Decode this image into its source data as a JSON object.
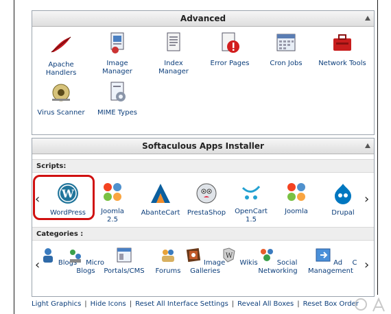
{
  "advanced": {
    "title": "Advanced",
    "items": [
      {
        "label": "Apache\nHandlers",
        "icon": "feather-icon"
      },
      {
        "label": "Image\nManager",
        "icon": "image-manager-icon"
      },
      {
        "label": "Index\nManager",
        "icon": "index-manager-icon"
      },
      {
        "label": "Error Pages",
        "icon": "error-pages-icon"
      },
      {
        "label": "Cron Jobs",
        "icon": "cron-jobs-icon"
      },
      {
        "label": "Network Tools",
        "icon": "network-tools-icon"
      },
      {
        "label": "Virus Scanner",
        "icon": "virus-scanner-icon"
      },
      {
        "label": "MIME Types",
        "icon": "mime-types-icon"
      }
    ]
  },
  "softaculous": {
    "title": "Softaculous Apps Installer",
    "scripts_label": "Scripts:",
    "scripts": [
      {
        "label": "WordPress",
        "icon": "wordpress-icon"
      },
      {
        "label": "Joomla\n2.5",
        "icon": "joomla-icon"
      },
      {
        "label": "AbanteCart",
        "icon": "abantecart-icon"
      },
      {
        "label": "PrestaShop",
        "icon": "prestashop-icon"
      },
      {
        "label": "OpenCart\n1.5",
        "icon": "opencart-icon"
      },
      {
        "label": "Joomla",
        "icon": "joomla-icon"
      },
      {
        "label": "Drupal",
        "icon": "drupal-icon"
      }
    ],
    "categories_label": "Categories :",
    "categories": [
      {
        "label": "Blogs",
        "icon": "blogs-icon"
      },
      {
        "label": "Micro\nBlogs",
        "icon": "micro-blogs-icon"
      },
      {
        "label": "Portals/CMS",
        "icon": "portals-icon"
      },
      {
        "label": "Forums",
        "icon": "forums-icon"
      },
      {
        "label": "Image\nGalleries",
        "icon": "image-galleries-icon"
      },
      {
        "label": "Wikis",
        "icon": "wikis-icon"
      },
      {
        "label": "Social\nNetworking",
        "icon": "social-networking-icon"
      },
      {
        "label": "Ad\nManagement",
        "icon": "ad-management-icon"
      },
      {
        "label": "C",
        "icon": "cut-off-icon"
      }
    ]
  },
  "footer": {
    "links": [
      "Light Graphics",
      "Hide Icons",
      "Reset All Interface Settings",
      "Reveal All Boxes",
      "Reset Box",
      "Order"
    ]
  }
}
